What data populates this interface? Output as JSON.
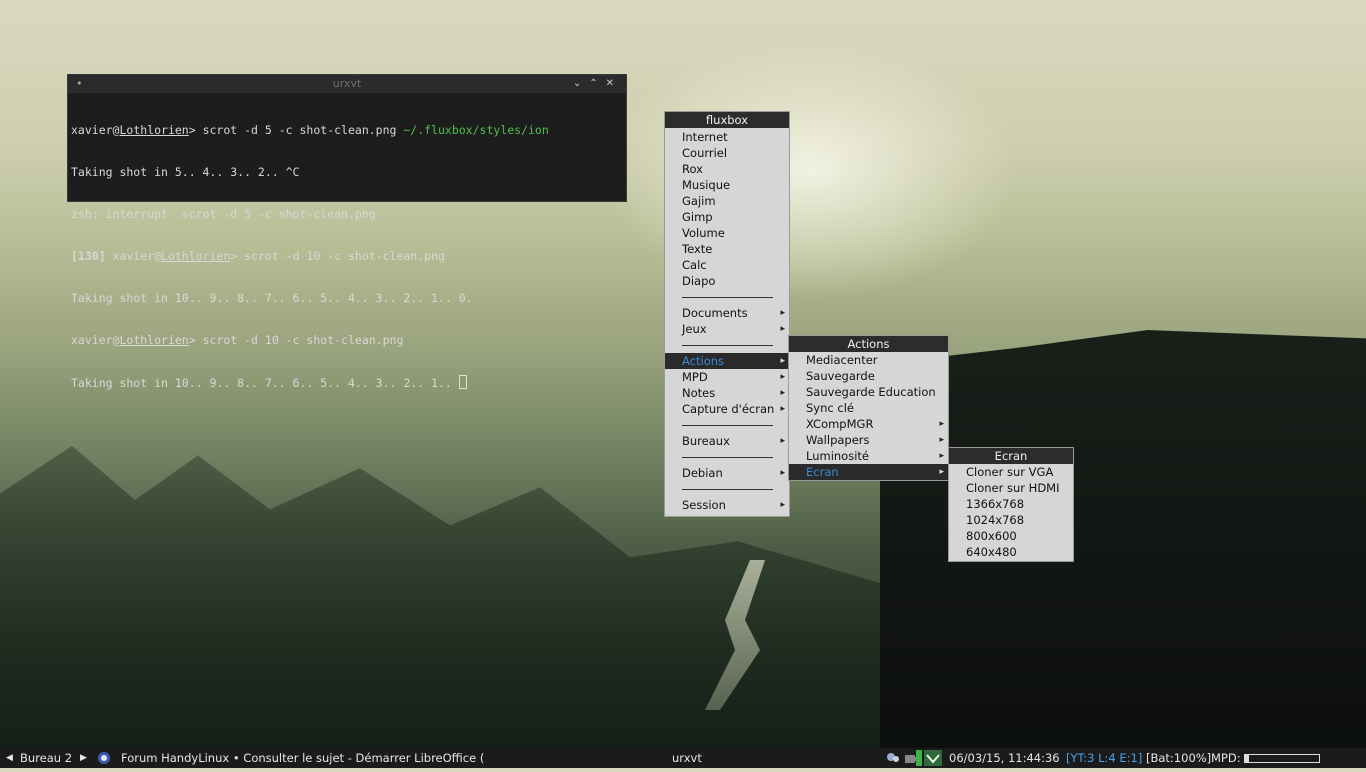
{
  "terminal": {
    "title": "urxvt",
    "lines": [
      {
        "user": "xavier",
        "host": "Lothlorien",
        "cmd": "> scrot -d 5 -c shot-clean.png ",
        "path": "~/.fluxbox/styles/ion"
      },
      {
        "text": "Taking shot in 5.. 4.. 3.. 2.. ^C"
      },
      {
        "text": "zsh: interrupt  scrot -d 5 -c shot-clean.png"
      },
      {
        "code": "[130]",
        "user": " xavier",
        "host": "Lothlorien",
        "cmd": "> scrot -d 10 -c shot-clean.png"
      },
      {
        "text": "Taking shot in 10.. 9.. 8.. 7.. 6.. 5.. 4.. 3.. 2.. 1.. 0."
      },
      {
        "user": "xavier",
        "host": "Lothlorien",
        "cmd": "> scrot -d 10 -c shot-clean.png"
      },
      {
        "text": "Taking shot in 10.. 9.. 8.. 7.. 6.. 5.. 4.. 3.. 2.. 1.. "
      }
    ]
  },
  "root_menu": {
    "title": "fluxbox",
    "items": [
      "Internet",
      "Courriel",
      "Rox",
      "Musique",
      "Gajim",
      "Gimp",
      "Volume",
      "Texte",
      "Calc",
      "Diapo"
    ],
    "group2": [
      "Documents",
      "Jeux"
    ],
    "group3": [
      "Actions",
      "MPD",
      "Notes",
      "Capture d'écran"
    ],
    "bureaux": "Bureaux",
    "debian": "Debian",
    "session": "Session"
  },
  "actions_menu": {
    "title": "Actions",
    "items": [
      "Mediacenter",
      "Sauvegarde",
      "Sauvegarde Education",
      "Sync clé",
      "XCompMGR",
      "Wallpapers",
      "Luminosité",
      "Ecran"
    ]
  },
  "ecran_menu": {
    "title": "Ecran",
    "items": [
      "Cloner sur VGA",
      "Cloner sur HDMI",
      "1366x768",
      "1024x768",
      "800x600",
      "640x480"
    ]
  },
  "taskbar": {
    "workspace": "Bureau 2",
    "window_title": "Forum HandyLinux • Consulter le sujet - Démarrer LibreOffice (",
    "center_title": "urxvt",
    "clock": "06/03/15, 11:44:36",
    "status_yt": "[YT:3 L:4 E:1]",
    "status_bat": "[Bat:100%]",
    "status_mpd": "MPD:",
    "mpd_progress": 0.06
  }
}
